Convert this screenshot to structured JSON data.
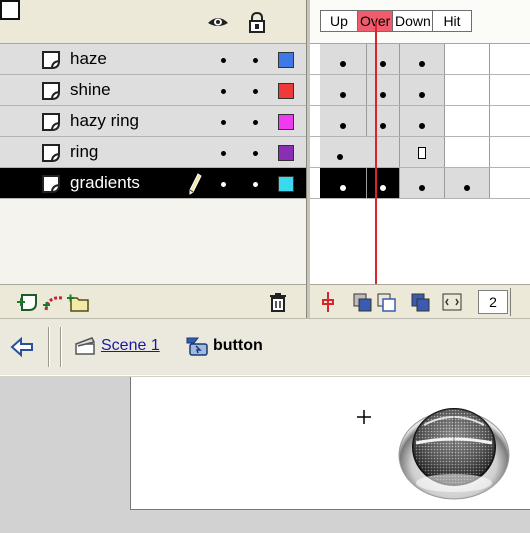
{
  "timeline": {
    "frame_tabs": [
      "Up",
      "Over",
      "Down",
      "Hit"
    ],
    "layers": [
      {
        "name": "haze",
        "color": "#3f79e8",
        "selected": false
      },
      {
        "name": "shine",
        "color": "#f03a3a",
        "selected": false
      },
      {
        "name": "hazy ring",
        "color": "#f03af0",
        "selected": false
      },
      {
        "name": "ring",
        "color": "#8a2fb5",
        "selected": false
      },
      {
        "name": "gradients",
        "color": "#3ad9ee",
        "selected": true
      }
    ],
    "current_frame": "2",
    "accent_colors": {
      "over_tab": "#ef5c6e",
      "playhead": "#d8242d"
    }
  },
  "edit_bar": {
    "scene": "Scene 1",
    "symbol": "button"
  }
}
